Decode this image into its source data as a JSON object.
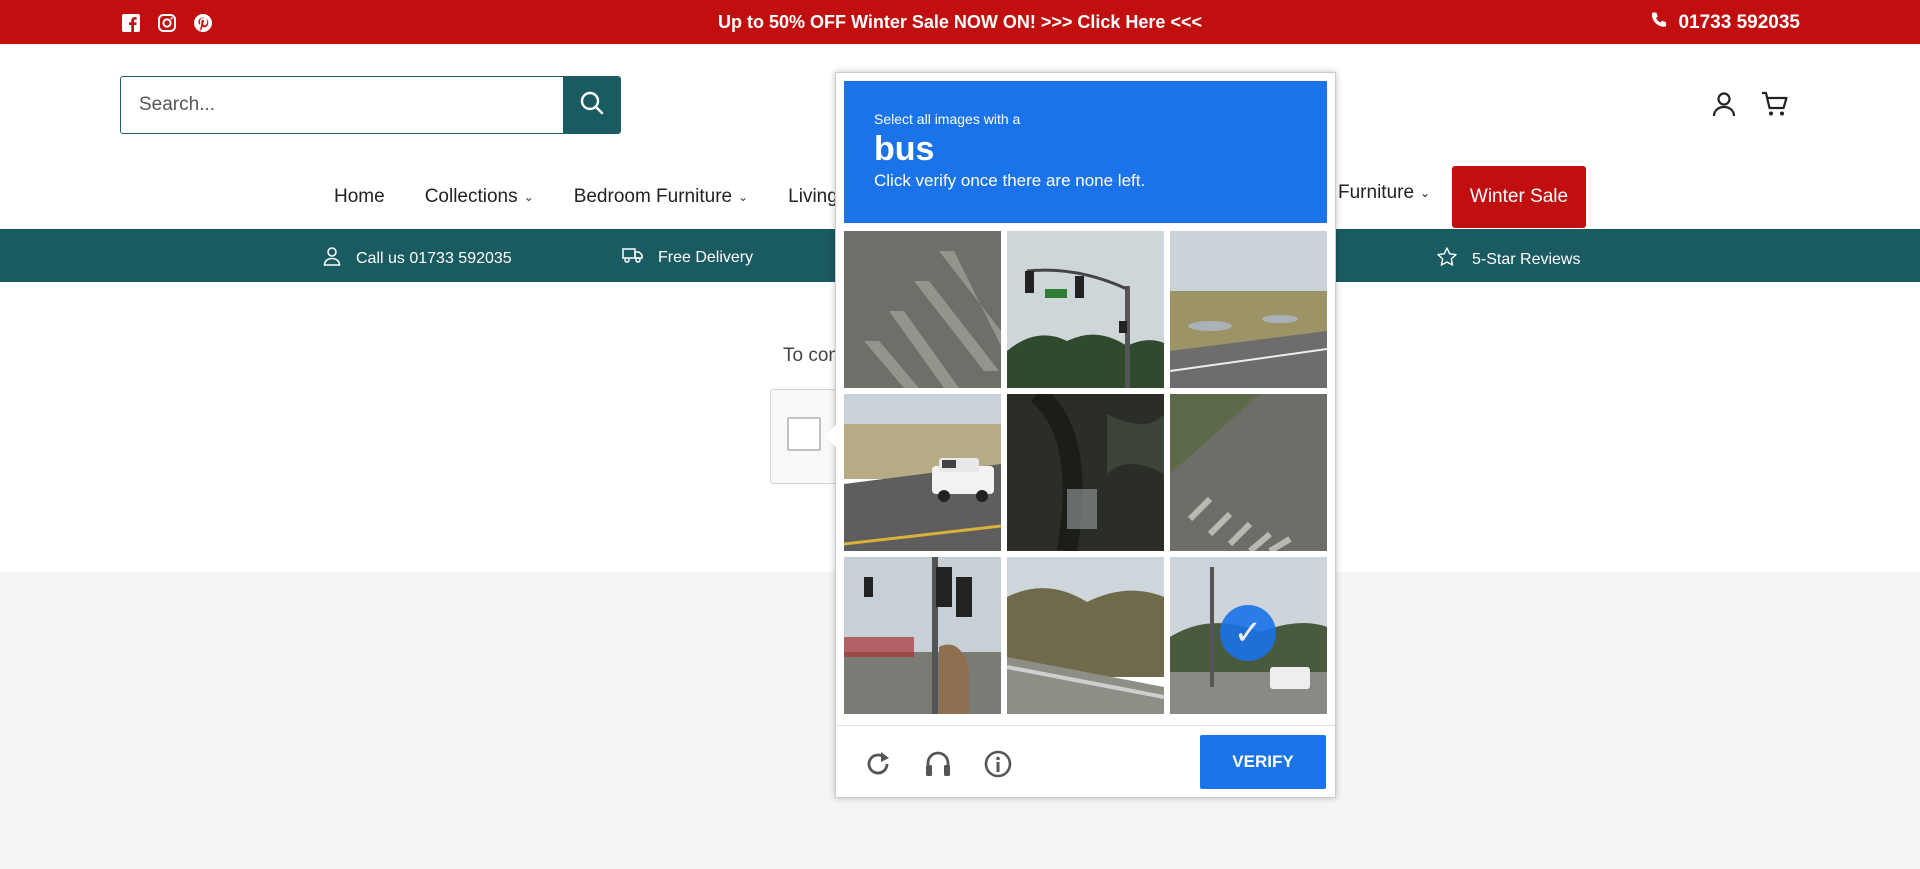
{
  "topbar": {
    "promo": "Up to 50% OFF Winter Sale NOW ON! >>> Click Here <<<",
    "phone": "01733 592035",
    "social": [
      "facebook-icon",
      "instagram-icon",
      "pinterest-icon"
    ]
  },
  "search": {
    "placeholder": "Search..."
  },
  "nav": {
    "items": [
      {
        "label": "Home"
      },
      {
        "label": "Collections"
      },
      {
        "label": "Bedroom Furniture"
      },
      {
        "label": "Living"
      }
    ],
    "partial_right": "Furniture",
    "sale": "Winter Sale"
  },
  "infobar": {
    "call": "Call us 01733 592035",
    "delivery": "Free Delivery",
    "reviews": "5-Star Reviews"
  },
  "body": {
    "continue_text": "To con"
  },
  "captcha": {
    "instruction": "Select all images with a",
    "target": "bus",
    "subtext": "Click verify once there are none left.",
    "verify": "VERIFY",
    "selected_tiles": [
      8
    ],
    "tools": [
      "reload-icon",
      "audio-icon",
      "info-icon"
    ]
  },
  "colors": {
    "brand_red": "#c10f0f",
    "brand_teal": "#1a5a61",
    "captcha_blue": "#1a73e8"
  }
}
